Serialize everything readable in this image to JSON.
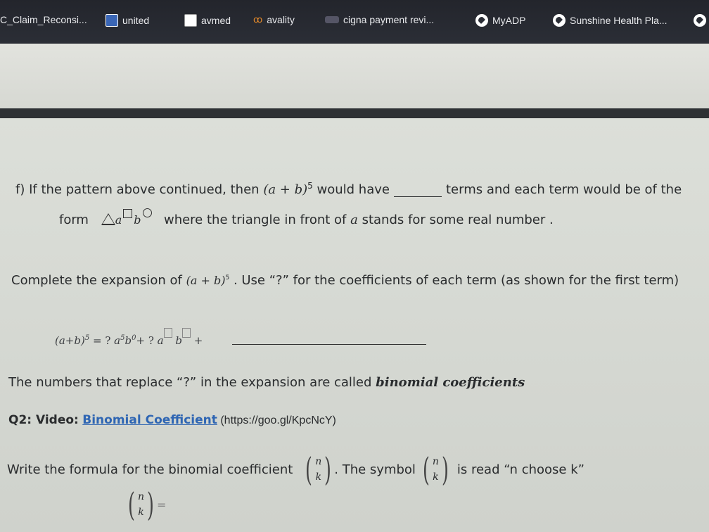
{
  "bookmarks": [
    {
      "label": "C_Claim_Reconsi...",
      "icon": "none"
    },
    {
      "label": "united",
      "icon": "united-icon"
    },
    {
      "label": "avmed",
      "icon": "avmed-icon"
    },
    {
      "label": "avality",
      "icon": "avality-icon"
    },
    {
      "label": "cigna payment revi...",
      "icon": "cigna-icon"
    },
    {
      "label": "MyADP",
      "icon": "globe-icon"
    },
    {
      "label": "Sunshine Health Pla...",
      "icon": "globe-icon"
    }
  ],
  "doc": {
    "f_prefix": "f) If the pattern above continued, then",
    "f_expr": "(a + b)",
    "f_exp": "5",
    "f_mid": "would have",
    "f_end": "terms and each term would be of the",
    "form_word": "form",
    "form_a": "a",
    "form_b": "b",
    "form_rest_1": "where the triangle  in front of",
    "form_rest_a": "a",
    "form_rest_2": "stands for some real number .",
    "complete_1": "Complete the expansion of",
    "complete_expr": "(a + b)",
    "complete_exp": "5",
    "complete_2": ". Use “?” for the coefficients of each term (as shown for the first term)",
    "exp_lhs": "(a+b)",
    "exp_lhs_exp": "5",
    "exp_eq": "= ?",
    "exp_a": "a",
    "exp_a_pow": "5",
    "exp_b": "b",
    "exp_b_pow": "0",
    "exp_plus1": "+",
    "exp_q2": "?",
    "exp_a2": "a",
    "exp_b2": "b",
    "exp_plus2": "+",
    "numbers_1": "The numbers that replace “?” in the expansion are called",
    "numbers_bold": "binomial coefficients",
    "q2_label": "Q2: Video:",
    "q2_link": "Binomial Coefficient",
    "q2_url": " (https://goo.gl/KpcNcY)",
    "write_1": "Write the formula for the binomial coefficient",
    "write_2": ". The symbol",
    "write_3": "is read “n choose k”",
    "binom_n": "n",
    "binom_k": "k",
    "eq_sign": "="
  }
}
